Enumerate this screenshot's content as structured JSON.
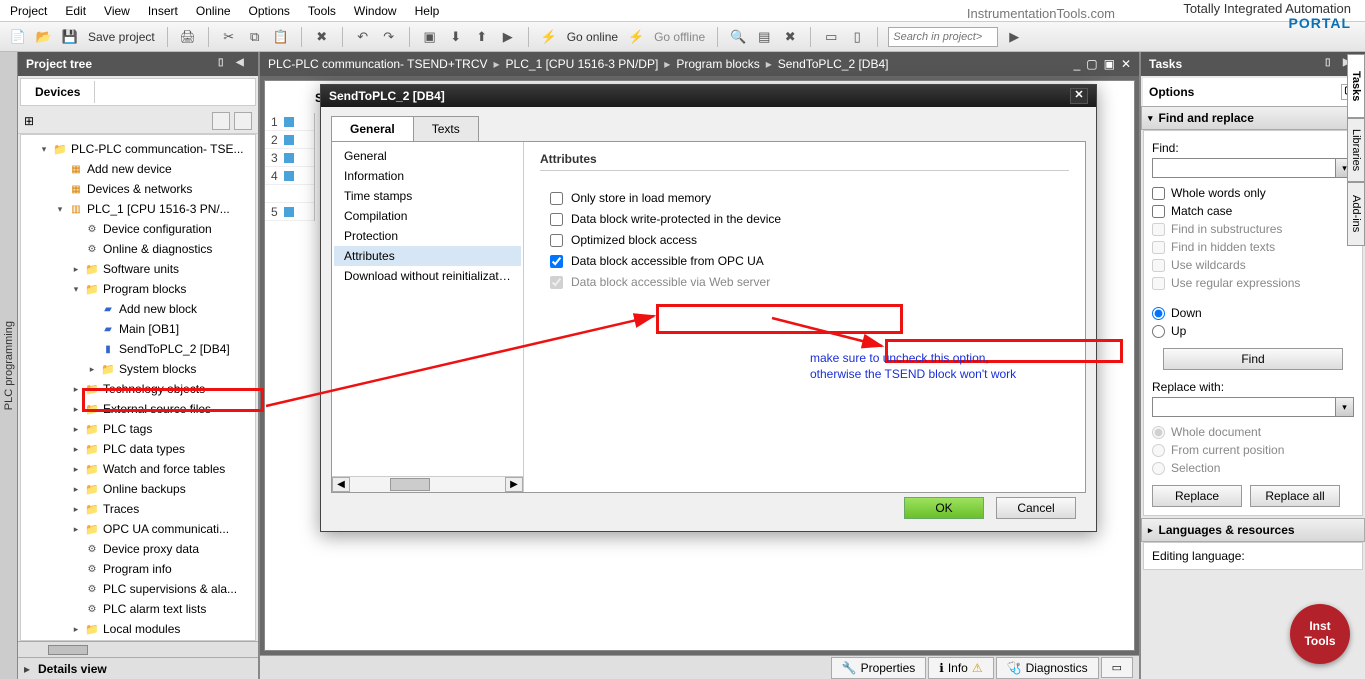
{
  "menu": [
    "Project",
    "Edit",
    "View",
    "Insert",
    "Online",
    "Options",
    "Tools",
    "Window",
    "Help"
  ],
  "brand": {
    "line1": "Totally Integrated Automation",
    "line2": "PORTAL"
  },
  "watermark": "InstrumentationTools.com",
  "toolbar": {
    "save": "Save project",
    "goonline": "Go online",
    "gooffline": "Go offline",
    "search_placeholder": "Search in project>"
  },
  "left_strip": "PLC programming",
  "tree": {
    "title": "Project tree",
    "devices_tab": "Devices",
    "items": [
      {
        "pl": 18,
        "exp": "▾",
        "ico": "icon-folder",
        "label": "PLC-PLC communcation- TSE..."
      },
      {
        "pl": 34,
        "exp": "",
        "ico": "icon-device",
        "label": "Add new device"
      },
      {
        "pl": 34,
        "exp": "",
        "ico": "icon-device",
        "label": "Devices & networks"
      },
      {
        "pl": 34,
        "exp": "▾",
        "ico": "icon-plc",
        "label": "PLC_1 [CPU 1516-3 PN/..."
      },
      {
        "pl": 50,
        "exp": "",
        "ico": "icon-gear",
        "label": "Device configuration"
      },
      {
        "pl": 50,
        "exp": "",
        "ico": "icon-gear",
        "label": "Online & diagnostics"
      },
      {
        "pl": 50,
        "exp": "▸",
        "ico": "icon-folder",
        "label": "Software units"
      },
      {
        "pl": 50,
        "exp": "▾",
        "ico": "icon-folder",
        "label": "Program blocks"
      },
      {
        "pl": 66,
        "exp": "",
        "ico": "icon-block",
        "label": "Add new block"
      },
      {
        "pl": 66,
        "exp": "",
        "ico": "icon-block",
        "label": "Main [OB1]"
      },
      {
        "pl": 66,
        "exp": "",
        "ico": "icon-db",
        "label": "SendToPLC_2 [DB4]",
        "sel": true
      },
      {
        "pl": 66,
        "exp": "▸",
        "ico": "icon-folder",
        "label": "System blocks"
      },
      {
        "pl": 50,
        "exp": "▸",
        "ico": "icon-folder",
        "label": "Technology objects"
      },
      {
        "pl": 50,
        "exp": "▸",
        "ico": "icon-folder",
        "label": "External source files"
      },
      {
        "pl": 50,
        "exp": "▸",
        "ico": "icon-folder",
        "label": "PLC tags"
      },
      {
        "pl": 50,
        "exp": "▸",
        "ico": "icon-folder",
        "label": "PLC data types"
      },
      {
        "pl": 50,
        "exp": "▸",
        "ico": "icon-folder",
        "label": "Watch and force tables"
      },
      {
        "pl": 50,
        "exp": "▸",
        "ico": "icon-folder",
        "label": "Online backups"
      },
      {
        "pl": 50,
        "exp": "▸",
        "ico": "icon-folder",
        "label": "Traces"
      },
      {
        "pl": 50,
        "exp": "▸",
        "ico": "icon-folder",
        "label": "OPC UA communicati..."
      },
      {
        "pl": 50,
        "exp": "",
        "ico": "icon-gear",
        "label": "Device proxy data"
      },
      {
        "pl": 50,
        "exp": "",
        "ico": "icon-gear",
        "label": "Program info"
      },
      {
        "pl": 50,
        "exp": "",
        "ico": "icon-gear",
        "label": "PLC supervisions & ala..."
      },
      {
        "pl": 50,
        "exp": "",
        "ico": "icon-gear",
        "label": "PLC alarm text lists"
      },
      {
        "pl": 50,
        "exp": "▸",
        "ico": "icon-folder",
        "label": "Local modules"
      }
    ],
    "details": "Details view"
  },
  "breadcrumb": [
    "PLC-PLC communcation- TSEND+TRCV",
    "PLC_1 [CPU 1516-3 PN/DP]",
    "Program blocks",
    "SendToPLC_2 [DB4]"
  ],
  "work": {
    "colhdr": "Se",
    "rows": [
      "1",
      "2",
      "3",
      "4",
      "",
      "5"
    ]
  },
  "dialog": {
    "title": "SendToPLC_2 [DB4]",
    "tabs": [
      "General",
      "Texts"
    ],
    "sidelist": [
      "General",
      "Information",
      "Time stamps",
      "Compilation",
      "Protection",
      "Attributes",
      "Download without reinitializati..."
    ],
    "sidelist_selected": 5,
    "section_title": "Attributes",
    "checks": [
      {
        "label": "Only store in load memory",
        "checked": false,
        "disabled": false
      },
      {
        "label": "Data block write-protected in the device",
        "checked": false,
        "disabled": false
      },
      {
        "label": "Optimized block access",
        "checked": false,
        "disabled": false,
        "highlight": true
      },
      {
        "label": "Data block accessible from OPC UA",
        "checked": true,
        "disabled": false
      },
      {
        "label": "Data block accessible via Web server",
        "checked": true,
        "disabled": true
      }
    ],
    "ok": "OK",
    "cancel": "Cancel"
  },
  "bottom_tabs": {
    "properties": "Properties",
    "info": "Info",
    "diagnostics": "Diagnostics"
  },
  "tasks": {
    "title": "Tasks",
    "options": "Options",
    "find_replace": "Find and replace",
    "find_label": "Find:",
    "whole": "Whole words only",
    "match": "Match case",
    "sub": "Find in substructures",
    "hidden": "Find in hidden texts",
    "wild": "Use wildcards",
    "regex": "Use regular expressions",
    "down": "Down",
    "up": "Up",
    "find_btn": "Find",
    "replace_label": "Replace with:",
    "whole_doc": "Whole document",
    "from_pos": "From current position",
    "selection": "Selection",
    "replace_btn": "Replace",
    "replace_all": "Replace all",
    "lang_hdr": "Languages & resources",
    "editing_lang": "Editing language:"
  },
  "right_tabs": [
    "Tasks",
    "Libraries",
    "Add-ins"
  ],
  "annotation": {
    "line1": "make sure to uncheck this option,",
    "line2": "otherwise the TSEND block won't work"
  },
  "badge": {
    "l1": "Inst",
    "l2": "Tools"
  }
}
